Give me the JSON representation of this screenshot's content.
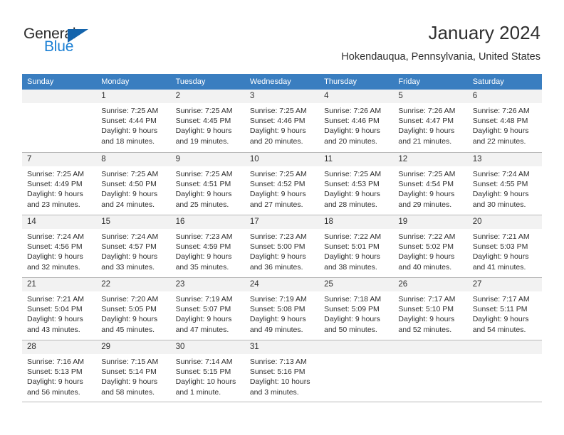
{
  "brand": {
    "name_part1": "General",
    "name_part2": "Blue",
    "triangle_color": "#1464ac",
    "blue_color": "#1a7fd4"
  },
  "header": {
    "title": "January 2024",
    "subtitle": "Hokendauqua, Pennsylvania, United States"
  },
  "theme": {
    "header_row_bg": "#3a7ec0",
    "daynum_bg": "#f2f2f2",
    "grid_line": "#b8b8b8",
    "text": "#2f2f2f"
  },
  "weekdays": [
    "Sunday",
    "Monday",
    "Tuesday",
    "Wednesday",
    "Thursday",
    "Friday",
    "Saturday"
  ],
  "weeks": [
    [
      {
        "day": "",
        "sunrise": "",
        "sunset": "",
        "daylight1": "",
        "daylight2": ""
      },
      {
        "day": "1",
        "sunrise": "Sunrise: 7:25 AM",
        "sunset": "Sunset: 4:44 PM",
        "daylight1": "Daylight: 9 hours",
        "daylight2": "and 18 minutes."
      },
      {
        "day": "2",
        "sunrise": "Sunrise: 7:25 AM",
        "sunset": "Sunset: 4:45 PM",
        "daylight1": "Daylight: 9 hours",
        "daylight2": "and 19 minutes."
      },
      {
        "day": "3",
        "sunrise": "Sunrise: 7:25 AM",
        "sunset": "Sunset: 4:46 PM",
        "daylight1": "Daylight: 9 hours",
        "daylight2": "and 20 minutes."
      },
      {
        "day": "4",
        "sunrise": "Sunrise: 7:26 AM",
        "sunset": "Sunset: 4:46 PM",
        "daylight1": "Daylight: 9 hours",
        "daylight2": "and 20 minutes."
      },
      {
        "day": "5",
        "sunrise": "Sunrise: 7:26 AM",
        "sunset": "Sunset: 4:47 PM",
        "daylight1": "Daylight: 9 hours",
        "daylight2": "and 21 minutes."
      },
      {
        "day": "6",
        "sunrise": "Sunrise: 7:26 AM",
        "sunset": "Sunset: 4:48 PM",
        "daylight1": "Daylight: 9 hours",
        "daylight2": "and 22 minutes."
      }
    ],
    [
      {
        "day": "7",
        "sunrise": "Sunrise: 7:25 AM",
        "sunset": "Sunset: 4:49 PM",
        "daylight1": "Daylight: 9 hours",
        "daylight2": "and 23 minutes."
      },
      {
        "day": "8",
        "sunrise": "Sunrise: 7:25 AM",
        "sunset": "Sunset: 4:50 PM",
        "daylight1": "Daylight: 9 hours",
        "daylight2": "and 24 minutes."
      },
      {
        "day": "9",
        "sunrise": "Sunrise: 7:25 AM",
        "sunset": "Sunset: 4:51 PM",
        "daylight1": "Daylight: 9 hours",
        "daylight2": "and 25 minutes."
      },
      {
        "day": "10",
        "sunrise": "Sunrise: 7:25 AM",
        "sunset": "Sunset: 4:52 PM",
        "daylight1": "Daylight: 9 hours",
        "daylight2": "and 27 minutes."
      },
      {
        "day": "11",
        "sunrise": "Sunrise: 7:25 AM",
        "sunset": "Sunset: 4:53 PM",
        "daylight1": "Daylight: 9 hours",
        "daylight2": "and 28 minutes."
      },
      {
        "day": "12",
        "sunrise": "Sunrise: 7:25 AM",
        "sunset": "Sunset: 4:54 PM",
        "daylight1": "Daylight: 9 hours",
        "daylight2": "and 29 minutes."
      },
      {
        "day": "13",
        "sunrise": "Sunrise: 7:24 AM",
        "sunset": "Sunset: 4:55 PM",
        "daylight1": "Daylight: 9 hours",
        "daylight2": "and 30 minutes."
      }
    ],
    [
      {
        "day": "14",
        "sunrise": "Sunrise: 7:24 AM",
        "sunset": "Sunset: 4:56 PM",
        "daylight1": "Daylight: 9 hours",
        "daylight2": "and 32 minutes."
      },
      {
        "day": "15",
        "sunrise": "Sunrise: 7:24 AM",
        "sunset": "Sunset: 4:57 PM",
        "daylight1": "Daylight: 9 hours",
        "daylight2": "and 33 minutes."
      },
      {
        "day": "16",
        "sunrise": "Sunrise: 7:23 AM",
        "sunset": "Sunset: 4:59 PM",
        "daylight1": "Daylight: 9 hours",
        "daylight2": "and 35 minutes."
      },
      {
        "day": "17",
        "sunrise": "Sunrise: 7:23 AM",
        "sunset": "Sunset: 5:00 PM",
        "daylight1": "Daylight: 9 hours",
        "daylight2": "and 36 minutes."
      },
      {
        "day": "18",
        "sunrise": "Sunrise: 7:22 AM",
        "sunset": "Sunset: 5:01 PM",
        "daylight1": "Daylight: 9 hours",
        "daylight2": "and 38 minutes."
      },
      {
        "day": "19",
        "sunrise": "Sunrise: 7:22 AM",
        "sunset": "Sunset: 5:02 PM",
        "daylight1": "Daylight: 9 hours",
        "daylight2": "and 40 minutes."
      },
      {
        "day": "20",
        "sunrise": "Sunrise: 7:21 AM",
        "sunset": "Sunset: 5:03 PM",
        "daylight1": "Daylight: 9 hours",
        "daylight2": "and 41 minutes."
      }
    ],
    [
      {
        "day": "21",
        "sunrise": "Sunrise: 7:21 AM",
        "sunset": "Sunset: 5:04 PM",
        "daylight1": "Daylight: 9 hours",
        "daylight2": "and 43 minutes."
      },
      {
        "day": "22",
        "sunrise": "Sunrise: 7:20 AM",
        "sunset": "Sunset: 5:05 PM",
        "daylight1": "Daylight: 9 hours",
        "daylight2": "and 45 minutes."
      },
      {
        "day": "23",
        "sunrise": "Sunrise: 7:19 AM",
        "sunset": "Sunset: 5:07 PM",
        "daylight1": "Daylight: 9 hours",
        "daylight2": "and 47 minutes."
      },
      {
        "day": "24",
        "sunrise": "Sunrise: 7:19 AM",
        "sunset": "Sunset: 5:08 PM",
        "daylight1": "Daylight: 9 hours",
        "daylight2": "and 49 minutes."
      },
      {
        "day": "25",
        "sunrise": "Sunrise: 7:18 AM",
        "sunset": "Sunset: 5:09 PM",
        "daylight1": "Daylight: 9 hours",
        "daylight2": "and 50 minutes."
      },
      {
        "day": "26",
        "sunrise": "Sunrise: 7:17 AM",
        "sunset": "Sunset: 5:10 PM",
        "daylight1": "Daylight: 9 hours",
        "daylight2": "and 52 minutes."
      },
      {
        "day": "27",
        "sunrise": "Sunrise: 7:17 AM",
        "sunset": "Sunset: 5:11 PM",
        "daylight1": "Daylight: 9 hours",
        "daylight2": "and 54 minutes."
      }
    ],
    [
      {
        "day": "28",
        "sunrise": "Sunrise: 7:16 AM",
        "sunset": "Sunset: 5:13 PM",
        "daylight1": "Daylight: 9 hours",
        "daylight2": "and 56 minutes."
      },
      {
        "day": "29",
        "sunrise": "Sunrise: 7:15 AM",
        "sunset": "Sunset: 5:14 PM",
        "daylight1": "Daylight: 9 hours",
        "daylight2": "and 58 minutes."
      },
      {
        "day": "30",
        "sunrise": "Sunrise: 7:14 AM",
        "sunset": "Sunset: 5:15 PM",
        "daylight1": "Daylight: 10 hours",
        "daylight2": "and 1 minute."
      },
      {
        "day": "31",
        "sunrise": "Sunrise: 7:13 AM",
        "sunset": "Sunset: 5:16 PM",
        "daylight1": "Daylight: 10 hours",
        "daylight2": "and 3 minutes."
      },
      {
        "day": "",
        "sunrise": "",
        "sunset": "",
        "daylight1": "",
        "daylight2": ""
      },
      {
        "day": "",
        "sunrise": "",
        "sunset": "",
        "daylight1": "",
        "daylight2": ""
      },
      {
        "day": "",
        "sunrise": "",
        "sunset": "",
        "daylight1": "",
        "daylight2": ""
      }
    ]
  ]
}
